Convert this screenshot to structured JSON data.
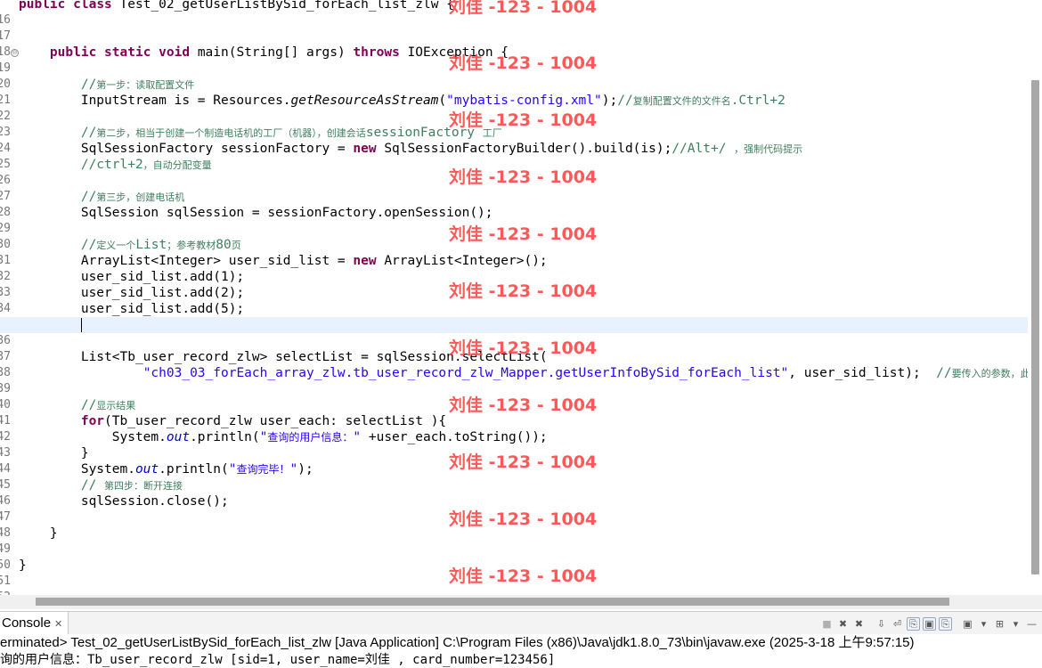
{
  "editor": {
    "lines": [
      {
        "num": "16",
        "text": "public class Test_02_getUserListBySid_forEach_list_zlw {"
      },
      {
        "num": "17",
        "text": ""
      },
      {
        "num": "18",
        "text": ""
      },
      {
        "num": "19",
        "text": "    public static void main(String[] args) throws IOException {"
      },
      {
        "num": "20",
        "text": ""
      },
      {
        "num": "21",
        "text": "        //第一步：读取配置文件"
      },
      {
        "num": "22",
        "text": "        InputStream is = Resources.getResourceAsStream(\"mybatis-config.xml\");//复制配置文件的文件名.Ctrl+2"
      },
      {
        "num": "23",
        "text": ""
      },
      {
        "num": "24",
        "text": "        //第二步，相当于创建一个制造电话机的工厂（机器），创建会话sessionFactory 工厂"
      },
      {
        "num": "25",
        "text": "        SqlSessionFactory sessionFactory = new SqlSessionFactoryBuilder().build(is);//Alt+/ ，强制代码提示"
      },
      {
        "num": "26",
        "text": "        //ctrl+2，自动分配变量"
      },
      {
        "num": "27",
        "text": ""
      },
      {
        "num": "28",
        "text": "        //第三步，创建电话机"
      },
      {
        "num": "29",
        "text": "        SqlSession sqlSession = sessionFactory.openSession();"
      },
      {
        "num": "30",
        "text": ""
      },
      {
        "num": "31",
        "text": "        //定义一个List；参考教材80页"
      },
      {
        "num": "32",
        "text": "        ArrayList<Integer> user_sid_list = new ArrayList<Integer>();"
      },
      {
        "num": "33",
        "text": "        user_sid_list.add(1);"
      },
      {
        "num": "34",
        "text": "        user_sid_list.add(2);"
      },
      {
        "num": "35",
        "text": "        user_sid_list.add(5);"
      },
      {
        "num": "36",
        "text": ""
      },
      {
        "num": "37",
        "text": ""
      },
      {
        "num": "38",
        "text": "        List<Tb_user_record_zlw> selectList = sqlSession.selectList("
      },
      {
        "num": "39",
        "text": "                \"ch03_03_forEach_array_zlw.tb_user_record_zlw_Mapper.getUserInfoBySid_forEach_list\", user_sid_list);  //要传入的参数，此"
      },
      {
        "num": "40",
        "text": ""
      },
      {
        "num": "41",
        "text": "        //显示结果"
      },
      {
        "num": "42",
        "text": "        for(Tb_user_record_zlw user_each: selectList ){"
      },
      {
        "num": "43",
        "text": "            System.out.println(\"查询的用户信息：\" +user_each.toString());"
      },
      {
        "num": "44",
        "text": "        }"
      },
      {
        "num": "45",
        "text": "        System.out.println(\"查询完毕！\");"
      },
      {
        "num": "46",
        "text": "        // 第四步：断开连接"
      },
      {
        "num": "47",
        "text": "        sqlSession.close();"
      },
      {
        "num": "48",
        "text": ""
      },
      {
        "num": "49",
        "text": "    }"
      },
      {
        "num": "50",
        "text": ""
      },
      {
        "num": "51",
        "text": "}"
      },
      {
        "num": "52",
        "text": ""
      }
    ]
  },
  "watermark": {
    "text": "刘佳 -123 - 1004"
  },
  "console": {
    "tab_label": "Console",
    "tab_close": "✕",
    "status": "erminated> Test_02_getUserListBySid_forEach_list_zlw [Java Application] C:\\Program Files (x86)\\Java\\jdk1.8.0_73\\bin\\javaw.exe (2025-3-18 上午9:57:15)",
    "output": "询的用户信息：Tb_user_record_zlw [sid=1, user_name=刘佳 , card_number=123456]"
  },
  "icons": {
    "terminate": "■",
    "remove": "✖",
    "remove_all": "✖",
    "scroll_lock": "⇩",
    "word_wrap": "⏎",
    "pin": "⎘",
    "display_selected": "▣",
    "open_console": "⊞",
    "view_menu": "▾",
    "minimize": "—",
    "fold": "⊖"
  },
  "colors": {
    "keyword": "#7f0055",
    "string": "#2a00ff",
    "comment": "#3f7f5f",
    "static_field": "#0000c0",
    "current_line": "#e8f2fe",
    "watermark": "#ff4a4a"
  }
}
